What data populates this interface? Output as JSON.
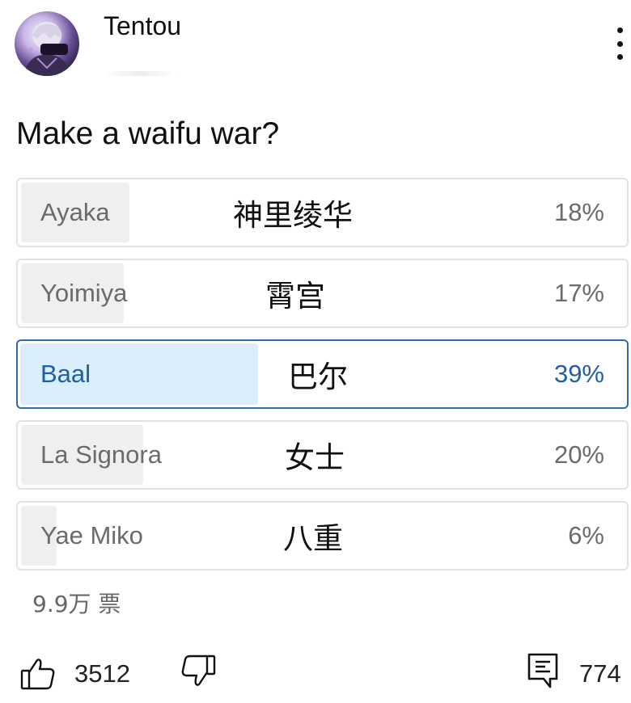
{
  "post": {
    "author": "Tentou",
    "avatar_icon": "anime-avatar-icon",
    "more_icon": "more-vertical-icon",
    "question": "Make a waifu war?"
  },
  "poll": {
    "options": [
      {
        "label": "Ayaka",
        "cn": "神里绫华",
        "percent_text": "18%",
        "percent": 18,
        "selected": false
      },
      {
        "label": "Yoimiya",
        "cn": "霄宫",
        "percent_text": "17%",
        "percent": 17,
        "selected": false
      },
      {
        "label": "Baal",
        "cn": "巴尔",
        "percent_text": "39%",
        "percent": 39,
        "selected": true
      },
      {
        "label": "La Signora",
        "cn": "女士",
        "percent_text": "20%",
        "percent": 20,
        "selected": false
      },
      {
        "label": "Yae Miko",
        "cn": "八重",
        "percent_text": "6%",
        "percent": 6,
        "selected": false
      }
    ],
    "vote_count": "9.9万 票"
  },
  "actions": {
    "like_icon": "thumbs-up-icon",
    "like_count": "3512",
    "dislike_icon": "thumbs-down-icon",
    "comment_icon": "comment-icon",
    "comment_count": "774"
  },
  "colors": {
    "selected_border": "#2b6cb0",
    "selected_fill": "#dbeefc",
    "selected_text": "#1f5ea8",
    "option_fill": "#efefef",
    "option_border": "#e2e2e2"
  }
}
